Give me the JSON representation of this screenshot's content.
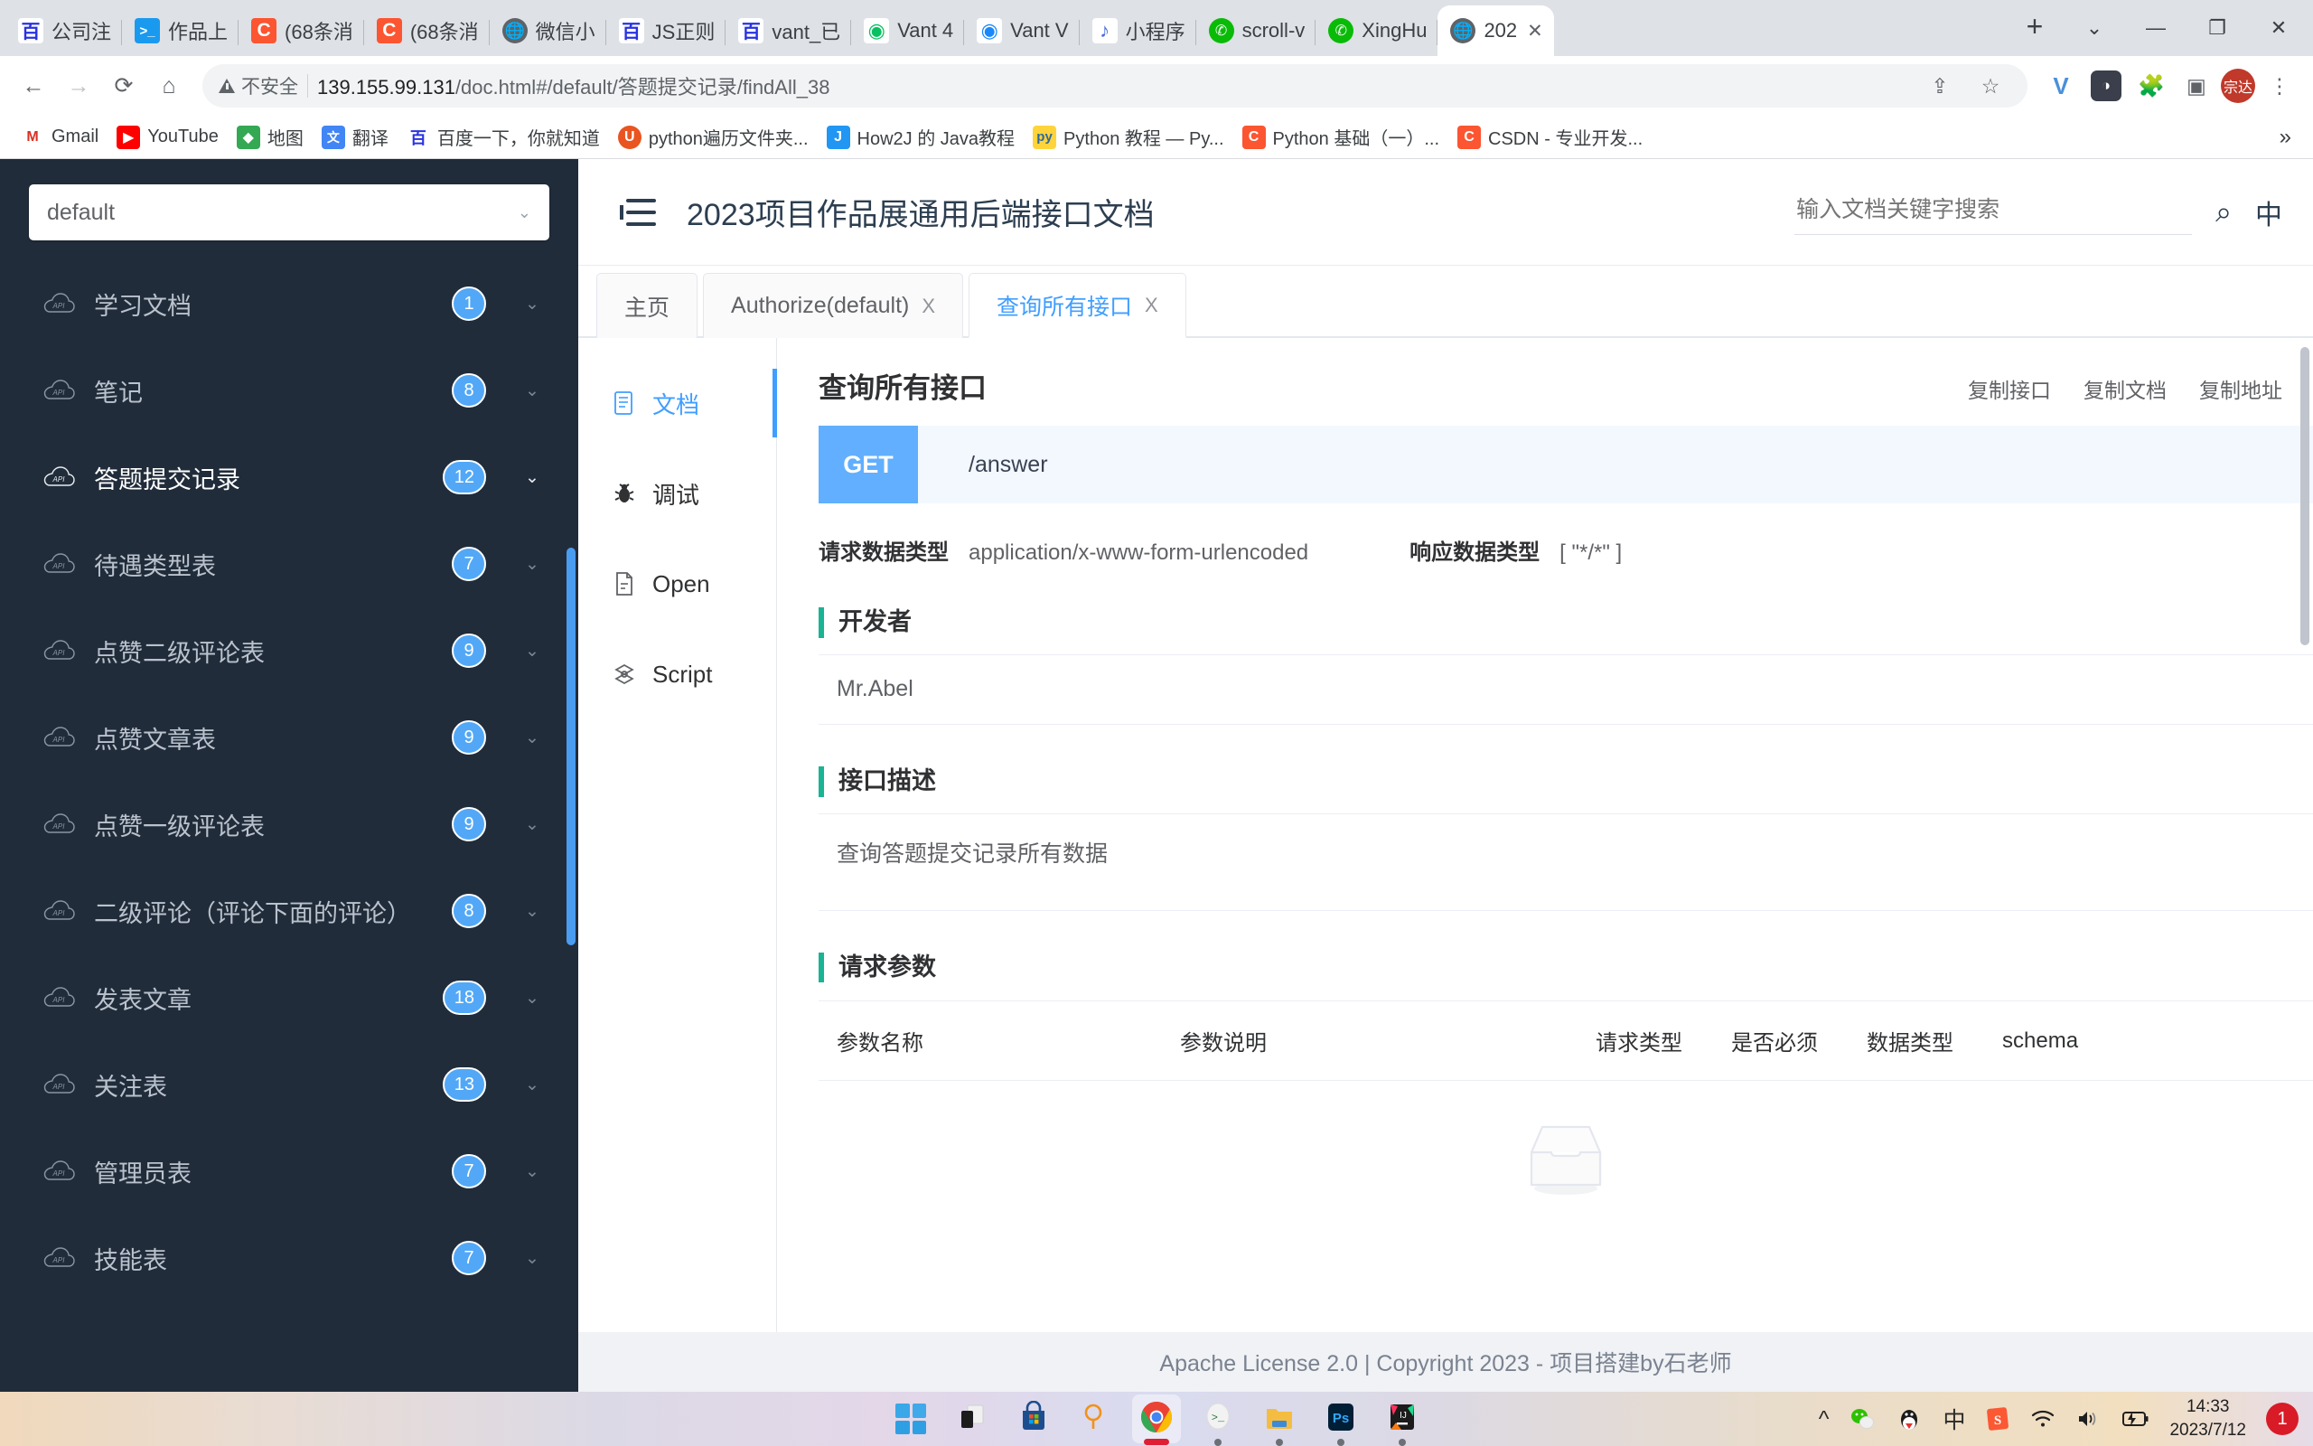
{
  "browser": {
    "tabs": [
      {
        "title": "公司注",
        "icon": "baidu-icon",
        "active": false
      },
      {
        "title": "作品上",
        "icon": "terminal-icon",
        "active": false
      },
      {
        "title": "(68条消",
        "icon": "csdn-icon",
        "active": false
      },
      {
        "title": "(68条消",
        "icon": "csdn-icon",
        "active": false
      },
      {
        "title": "微信小",
        "icon": "globe-icon",
        "active": false
      },
      {
        "title": "JS正则",
        "icon": "baidu-icon",
        "active": false
      },
      {
        "title": "vant_已",
        "icon": "baidu-icon",
        "active": false
      },
      {
        "title": "Vant 4",
        "icon": "vant-green-icon",
        "active": false
      },
      {
        "title": "Vant V",
        "icon": "vant-blue-icon",
        "active": false
      },
      {
        "title": "小程序",
        "icon": "miniprogram-icon",
        "active": false
      },
      {
        "title": "scroll-v",
        "icon": "wechat-icon",
        "active": false
      },
      {
        "title": "XingHu",
        "icon": "wechat-icon",
        "active": false
      },
      {
        "title": "202",
        "icon": "globe-icon",
        "active": true
      }
    ],
    "new_tab_label": "+",
    "tab_close_label": "✕",
    "window_controls": {
      "list": "⌄",
      "minimize": "—",
      "maximize": "❐",
      "close": "✕"
    },
    "nav": {
      "back": "←",
      "forward": "→",
      "reload": "⟳",
      "home": "⌂"
    },
    "omnibox": {
      "security_label": "不安全",
      "url_host": "139.155.99.131",
      "url_path": "/doc.html#/default/答题提交记录/findAll_38",
      "share_icon": "share-icon",
      "bookmark_icon": "star-icon"
    },
    "toolbar_icons": [
      "v-extension-icon",
      "dark-extension-icon",
      "puzzle-extension-icon",
      "sidepanel-icon"
    ],
    "profile_initials": "宗达",
    "bookmarks": [
      {
        "label": "Gmail",
        "icon": "gmail-icon",
        "color": "#ffffff",
        "glyph": "M",
        "fg": "#d93025"
      },
      {
        "label": "YouTube",
        "icon": "youtube-icon",
        "color": "#ff0000",
        "glyph": "▶",
        "fg": "#ffffff"
      },
      {
        "label": "地图",
        "icon": "maps-icon",
        "color": "#34a853",
        "glyph": "◆",
        "fg": "#ffffff"
      },
      {
        "label": "翻译",
        "icon": "translate-icon",
        "color": "#4285f4",
        "glyph": "文",
        "fg": "#ffffff"
      },
      {
        "label": "百度一下，你就知道",
        "icon": "baidu-icon",
        "color": "#ffffff",
        "glyph": "百",
        "fg": "#2932e1"
      },
      {
        "label": "python遍历文件夹...",
        "icon": "ubuntu-icon",
        "color": "#e95420",
        "glyph": "U",
        "fg": "#ffffff"
      },
      {
        "label": "How2J 的 Java教程",
        "icon": "how2j-icon",
        "color": "#2196f3",
        "glyph": "J",
        "fg": "#ffffff"
      },
      {
        "label": "Python 教程 — Py...",
        "icon": "python-icon",
        "color": "#ffd43b",
        "glyph": "🐍",
        "fg": "#306998"
      },
      {
        "label": "Python 基础（一）...",
        "icon": "csdn-icon",
        "color": "#fc5531",
        "glyph": "C",
        "fg": "#ffffff"
      },
      {
        "label": "CSDN - 专业开发...",
        "icon": "csdn-icon",
        "color": "#fc5531",
        "glyph": "C",
        "fg": "#ffffff"
      }
    ],
    "bookmarks_overflow": "»"
  },
  "sidebar": {
    "group_select": {
      "value": "default",
      "chevron": "chevron-down-icon"
    },
    "items": [
      {
        "label": "学习文档",
        "count": "1",
        "active": false
      },
      {
        "label": "笔记",
        "count": "8",
        "active": false
      },
      {
        "label": "答题提交记录",
        "count": "12",
        "active": true
      },
      {
        "label": "待遇类型表",
        "count": "7",
        "active": false
      },
      {
        "label": "点赞二级评论表",
        "count": "9",
        "active": false
      },
      {
        "label": "点赞文章表",
        "count": "9",
        "active": false
      },
      {
        "label": "点赞一级评论表",
        "count": "9",
        "active": false
      },
      {
        "label": "二级评论（评论下面的评论）",
        "count": "8",
        "active": false
      },
      {
        "label": "发表文章",
        "count": "18",
        "active": false
      },
      {
        "label": "关注表",
        "count": "13",
        "active": false
      },
      {
        "label": "管理员表",
        "count": "7",
        "active": false
      },
      {
        "label": "技能表",
        "count": "7",
        "active": false
      }
    ]
  },
  "app": {
    "menu_toggle_icon": "collapse-menu-icon",
    "title": "2023项目作品展通用后端接口文档",
    "search": {
      "placeholder": "输入文档关键字搜索",
      "value": ""
    },
    "search_icon": "search-icon",
    "language_label": "中",
    "tabs": [
      {
        "label": "主页",
        "closable": false,
        "active": false
      },
      {
        "label": "Authorize(default)",
        "closable": true,
        "active": false
      },
      {
        "label": "查询所有接口",
        "closable": true,
        "active": true
      }
    ],
    "tab_close_label": "X",
    "subnav": [
      {
        "label": "文档",
        "icon": "document-icon",
        "active": true
      },
      {
        "label": "调试",
        "icon": "bug-icon",
        "active": false
      },
      {
        "label": "Open",
        "icon": "file-icon",
        "active": false
      },
      {
        "label": "Script",
        "icon": "script-icon",
        "active": false
      }
    ],
    "doc": {
      "title": "查询所有接口",
      "copy_actions": [
        "复制接口",
        "复制文档",
        "复制地址"
      ],
      "method": "GET",
      "path": "/answer",
      "request_type_label": "请求数据类型",
      "request_type_value": "application/x-www-form-urlencoded",
      "response_type_label": "响应数据类型",
      "response_type_value": "[ \"*/*\" ]",
      "developer_section_title": "开发者",
      "developer_value": "Mr.Abel",
      "description_section_title": "接口描述",
      "description_value": "查询答题提交记录所有数据",
      "params_section_title": "请求参数",
      "params_columns": [
        "参数名称",
        "参数说明",
        "请求类型",
        "是否必须",
        "数据类型",
        "schema"
      ],
      "params_rows": [],
      "empty_icon": "empty-inbox-icon"
    },
    "footer": "Apache License 2.0 | Copyright 2023 - 项目搭建by石老师"
  },
  "taskbar": {
    "apps": [
      {
        "name": "start-button",
        "running": false,
        "active": false
      },
      {
        "name": "task-view-button",
        "running": false,
        "active": false
      },
      {
        "name": "microsoft-store",
        "running": false,
        "active": false
      },
      {
        "name": "search-magnifier",
        "running": false,
        "active": false
      },
      {
        "name": "google-chrome",
        "running": false,
        "active": true
      },
      {
        "name": "terminal-app",
        "running": true,
        "active": false
      },
      {
        "name": "file-explorer",
        "running": true,
        "active": false
      },
      {
        "name": "photoshop",
        "running": true,
        "active": false
      },
      {
        "name": "intellij-idea",
        "running": true,
        "active": false
      }
    ],
    "tray": {
      "expand": "^",
      "icons": [
        "wechat-icon",
        "qq-icon",
        "ime-chinese-icon",
        "sogou-icon",
        "wifi-icon",
        "volume-icon",
        "battery-icon"
      ],
      "ime_label": "中",
      "time": "14:33",
      "date": "2023/7/12",
      "notification_count": "1"
    }
  }
}
